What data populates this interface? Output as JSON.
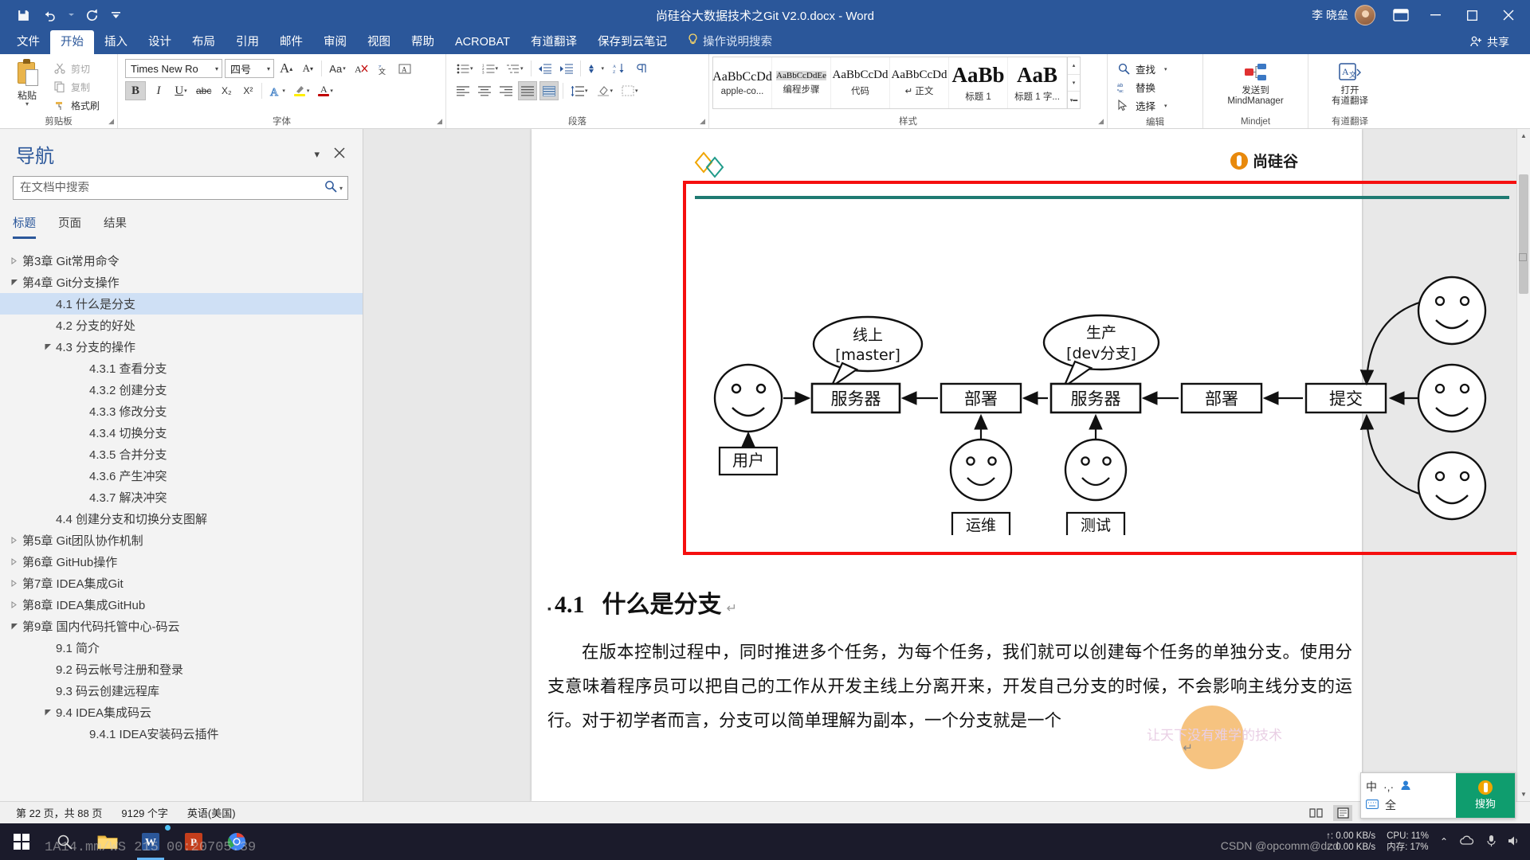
{
  "titlebar": {
    "document_title": "尚硅谷大数据技术之Git V2.0.docx  -  Word",
    "user_name": "李 晓垒",
    "qat": [
      {
        "name": "save",
        "glyph": "save-icon"
      },
      {
        "name": "undo",
        "glyph": "undo-icon"
      },
      {
        "name": "redo",
        "glyph": "redo-icon"
      },
      {
        "name": "customize",
        "glyph": "chevron-down-icon"
      }
    ],
    "window_buttons": {
      "minimize": "—",
      "maximize": "❐",
      "close": "✕"
    }
  },
  "tabs": [
    {
      "label": "文件",
      "active": false
    },
    {
      "label": "开始",
      "active": true
    },
    {
      "label": "插入",
      "active": false
    },
    {
      "label": "设计",
      "active": false
    },
    {
      "label": "布局",
      "active": false
    },
    {
      "label": "引用",
      "active": false
    },
    {
      "label": "邮件",
      "active": false
    },
    {
      "label": "审阅",
      "active": false
    },
    {
      "label": "视图",
      "active": false
    },
    {
      "label": "帮助",
      "active": false
    },
    {
      "label": "ACROBAT",
      "active": false
    },
    {
      "label": "有道翻译",
      "active": false
    },
    {
      "label": "保存到云笔记",
      "active": false
    }
  ],
  "tellme": {
    "label": "操作说明搜索"
  },
  "share": {
    "label": "共享"
  },
  "ribbon": {
    "clipboard": {
      "group_label": "剪贴板",
      "paste_label": "粘贴",
      "items": [
        {
          "label": "剪切",
          "icon": "scissors-icon"
        },
        {
          "label": "复制",
          "icon": "copy-icon"
        },
        {
          "label": "格式刷",
          "icon": "format-painter-icon"
        }
      ]
    },
    "font": {
      "group_label": "字体",
      "font_name": "Times New Ro",
      "font_size": "四号",
      "grow_label": "A",
      "shrink_label": "A",
      "case_label": "Aa",
      "clear_label": "✐",
      "bold": "B",
      "italic": "I",
      "underline": "U",
      "strike": "abc",
      "subscript": "X₂",
      "superscript": "X²",
      "text_effect": "A",
      "highlight": "ab",
      "font_color": "A",
      "char_border": "A",
      "phonetic": "文",
      "accent_color": "#c00000",
      "highlight_color": "#ffee00"
    },
    "paragraph": {
      "group_label": "段落",
      "buttons": [
        "bullets-icon",
        "numbering-icon",
        "multilevel-icon",
        "decrease-indent-icon",
        "increase-indent-icon",
        "sort-icon",
        "show-marks-icon",
        "align-left-icon",
        "align-center-icon",
        "align-right-icon",
        "justify-icon",
        "distribute-icon",
        "line-spacing-icon",
        "shading-icon",
        "borders-icon"
      ]
    },
    "styles": {
      "group_label": "样式",
      "items": [
        {
          "preview": "AaBbCcDd",
          "name": "apple-co...",
          "selected": false
        },
        {
          "preview": "AaBbCcDdEе",
          "name": "编程步骤",
          "selected": true
        },
        {
          "preview": "AaBbCcDd",
          "name": "代码",
          "selected": false
        },
        {
          "preview": "AaBbCcDd",
          "name": "↵ 正文",
          "selected": false
        },
        {
          "preview": "AaBb",
          "name": "标题 1",
          "selected": false
        },
        {
          "preview": "AaB",
          "name": "标题 1 字...",
          "selected": false
        }
      ]
    },
    "editing": {
      "group_label": "编辑",
      "items": [
        {
          "label": "查找",
          "icon": "search-icon"
        },
        {
          "label": "替换",
          "icon": "replace-icon"
        },
        {
          "label": "选择",
          "icon": "select-icon"
        }
      ]
    },
    "mindjet": {
      "group_label": "Mindjet",
      "button_line1": "发送到",
      "button_line2": "MindManager"
    },
    "youdao": {
      "group_label": "有道翻译",
      "button_line1": "打开",
      "button_line2": "有道翻译"
    }
  },
  "navigation": {
    "title": "导航",
    "collapse_icon": "chevron-down-icon",
    "close_icon": "close-icon",
    "search": {
      "placeholder": "在文档中搜索",
      "value": "",
      "icon": "search-icon",
      "dropdown": "chevron-down-icon"
    },
    "tabs": [
      {
        "label": "标题",
        "active": true
      },
      {
        "label": "页面",
        "active": false
      },
      {
        "label": "结果",
        "active": false
      }
    ],
    "tree": [
      {
        "label": "第3章 Git常用命令",
        "level": 0,
        "arrow": "collapsed",
        "selected": false
      },
      {
        "label": "第4章 Git分支操作",
        "level": 0,
        "arrow": "expanded",
        "selected": false
      },
      {
        "label": "4.1 什么是分支",
        "level": 1,
        "arrow": "none",
        "selected": true
      },
      {
        "label": "4.2 分支的好处",
        "level": 1,
        "arrow": "none",
        "selected": false
      },
      {
        "label": "4.3 分支的操作",
        "level": 1,
        "arrow": "expanded",
        "selected": false
      },
      {
        "label": "4.3.1 查看分支",
        "level": 2,
        "arrow": "none",
        "selected": false
      },
      {
        "label": "4.3.2 创建分支",
        "level": 2,
        "arrow": "none",
        "selected": false
      },
      {
        "label": "4.3.3 修改分支",
        "level": 2,
        "arrow": "none",
        "selected": false
      },
      {
        "label": "4.3.4 切换分支",
        "level": 2,
        "arrow": "none",
        "selected": false
      },
      {
        "label": "4.3.5 合并分支",
        "level": 2,
        "arrow": "none",
        "selected": false
      },
      {
        "label": "4.3.6 产生冲突",
        "level": 2,
        "arrow": "none",
        "selected": false
      },
      {
        "label": "4.3.7 解决冲突",
        "level": 2,
        "arrow": "none",
        "selected": false
      },
      {
        "label": "4.4 创建分支和切换分支图解",
        "level": 1,
        "arrow": "none",
        "selected": false
      },
      {
        "label": "第5章 Git团队协作机制",
        "level": 0,
        "arrow": "collapsed",
        "selected": false
      },
      {
        "label": "第6章 GitHub操作",
        "level": 0,
        "arrow": "collapsed",
        "selected": false
      },
      {
        "label": "第7章 IDEA集成Git",
        "level": 0,
        "arrow": "collapsed",
        "selected": false
      },
      {
        "label": "第8章 IDEA集成GitHub",
        "level": 0,
        "arrow": "collapsed",
        "selected": false
      },
      {
        "label": "第9章 国内代码托管中心-码云",
        "level": 0,
        "arrow": "expanded",
        "selected": false
      },
      {
        "label": "9.1 简介",
        "level": 1,
        "arrow": "none",
        "selected": false
      },
      {
        "label": "9.2 码云帐号注册和登录",
        "level": 1,
        "arrow": "none",
        "selected": false
      },
      {
        "label": "9.3 码云创建远程库",
        "level": 1,
        "arrow": "none",
        "selected": false
      },
      {
        "label": "9.4 IDEA集成码云",
        "level": 1,
        "arrow": "expanded",
        "selected": false
      },
      {
        "label": "9.4.1 IDEA安装码云插件",
        "level": 2,
        "arrow": "none",
        "selected": false
      }
    ]
  },
  "document": {
    "brand": {
      "text": "尚硅谷"
    },
    "watermark": "让天下没有难学的技术",
    "heading": {
      "bullet": "▪",
      "number": "4.1",
      "text": "什么是分支",
      "return_mark": "↵"
    },
    "body_paragraph": "在版本控制过程中，同时推进多个任务，为每个任务，我们就可以创建每个任务的单独分支。使用分支意味着程序员可以把自己的工作从开发主线上分离开来，开发自己分支的时候，不会影响主线分支的运行。对于初学者而言，分支可以简单理解为副本，一个分支就是一个",
    "diagram": {
      "callouts": [
        {
          "line1": "线上",
          "line2": "[master]"
        },
        {
          "line1": "生产",
          "line2": "[dev分支]"
        }
      ],
      "boxes": [
        {
          "label": "用户"
        },
        {
          "label": "服务器"
        },
        {
          "label": "部署"
        },
        {
          "label": "服务器"
        },
        {
          "label": "部署"
        },
        {
          "label": "提交"
        },
        {
          "label": "运维"
        },
        {
          "label": "测试"
        }
      ]
    }
  },
  "statusbar": {
    "page_info": "第 22 页，共 88 页",
    "word_count": "9129 个字",
    "language": "英语(美国)",
    "zoom_level": "",
    "views": [
      "read-view-icon",
      "print-view-icon",
      "web-view-icon"
    ],
    "zoom_out": "−",
    "zoom_in": "+"
  },
  "taskbar": {
    "start_icon": "windows-start-icon",
    "search_icon": "search-icon",
    "apps": [
      {
        "name": "file-explorer-icon",
        "active": false
      },
      {
        "name": "word-icon",
        "active": true
      },
      {
        "name": "powerpoint-icon",
        "active": false
      },
      {
        "name": "chrome-icon",
        "active": false
      }
    ],
    "net_up": "↑: 0.00 KB/s",
    "net_down": "↓: 0.00 KB/s",
    "cpu": "CPU: 11%",
    "memory": "内存: 17%",
    "osd_overlay": "1A14.mm/WS 215  00:20705:39",
    "csdn_text": "CSDN @opcomm@dzd"
  },
  "ime": {
    "mode_cn": "中",
    "mode_symbols": "·,·",
    "keyboard": "⌨",
    "full_width": "全",
    "brand": "搜狗"
  }
}
